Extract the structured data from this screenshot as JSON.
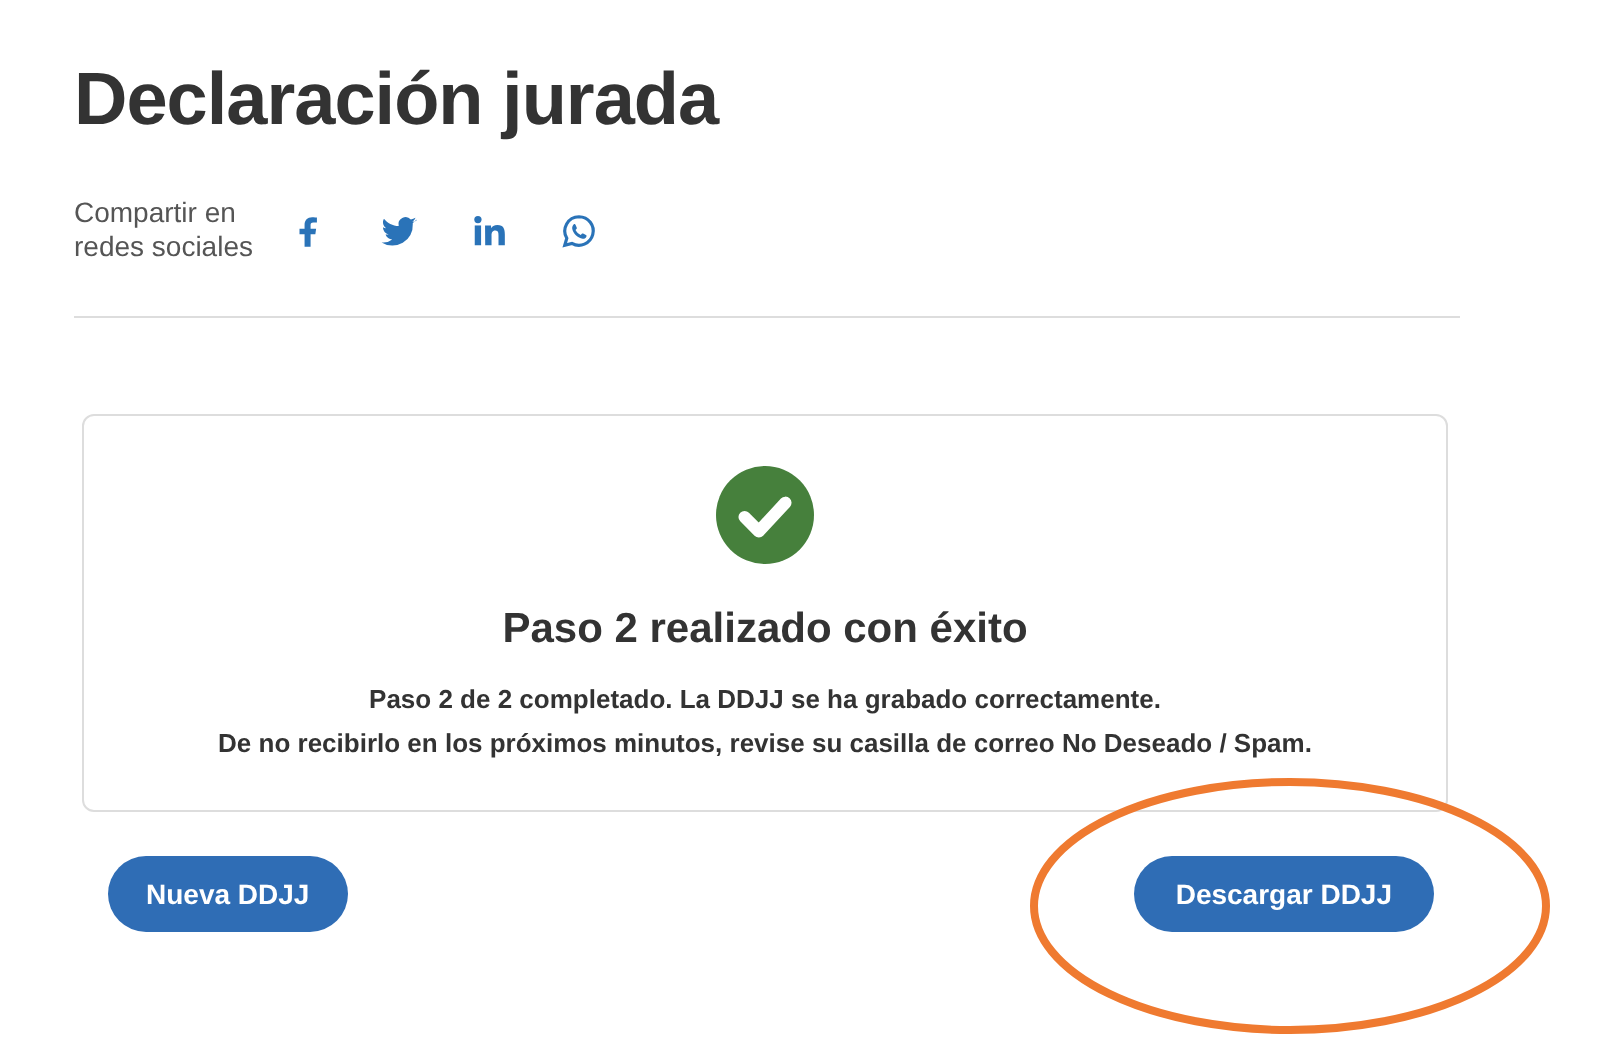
{
  "page_title": "Declaración jurada",
  "share": {
    "label_lines": [
      "Compartir en",
      "redes sociales"
    ],
    "networks": [
      {
        "kind": "facebook"
      },
      {
        "kind": "twitter"
      },
      {
        "kind": "linkedin"
      },
      {
        "kind": "whatsapp"
      }
    ]
  },
  "result_card": {
    "kind": "success",
    "heading": "Paso 2 realizado con éxito",
    "message_lines": [
      "Paso 2 de 2 completado. La DDJJ se ha grabado correctamente.",
      "De no recibirlo en los próximos minutos, revise su casilla de correo No Deseado / Spam."
    ]
  },
  "buttons": [
    {
      "label": "Nueva DDJJ",
      "highlighted": false
    },
    {
      "label": "Descargar DDJJ",
      "highlighted": true
    }
  ]
}
